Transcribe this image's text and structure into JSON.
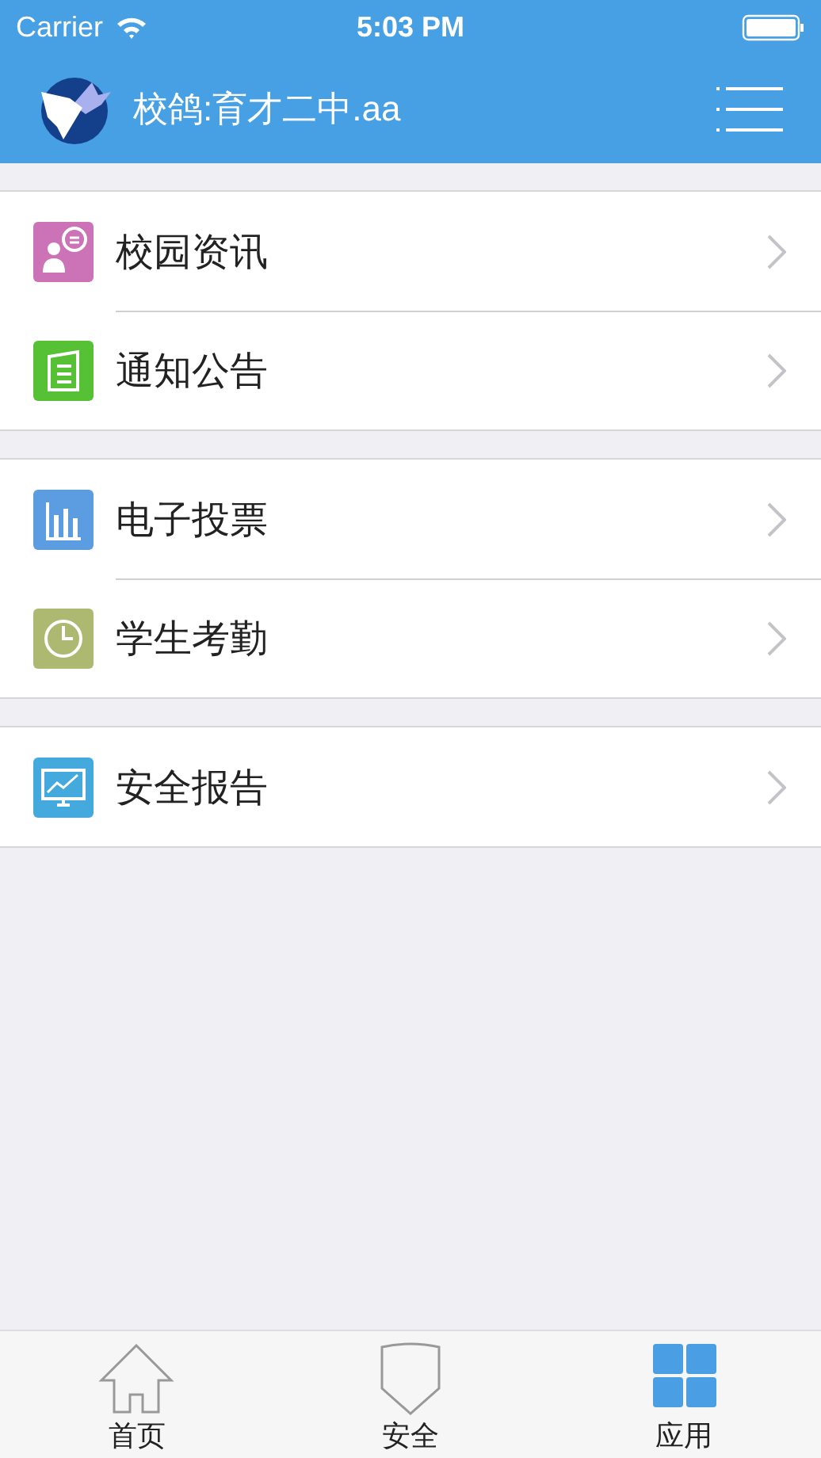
{
  "status_bar": {
    "carrier": "Carrier",
    "time": "5:03 PM"
  },
  "nav_bar": {
    "title": "校鸽:育才二中.aa"
  },
  "groups": [
    {
      "items": [
        {
          "label": "校园资讯",
          "kind": "news",
          "color": "#cc72b6"
        },
        {
          "label": "通知公告",
          "kind": "notice",
          "color": "#56c134"
        }
      ]
    },
    {
      "items": [
        {
          "label": "电子投票",
          "kind": "vote",
          "color": "#5b9de0"
        },
        {
          "label": "学生考勤",
          "kind": "attendance",
          "color": "#adb870"
        }
      ]
    },
    {
      "items": [
        {
          "label": "安全报告",
          "kind": "report",
          "color": "#44aadd"
        }
      ]
    }
  ],
  "tabs": [
    {
      "label": "首页",
      "kind": "home",
      "selected": false
    },
    {
      "label": "安全",
      "kind": "shield",
      "selected": false
    },
    {
      "label": "应用",
      "kind": "apps",
      "selected": true
    }
  ]
}
